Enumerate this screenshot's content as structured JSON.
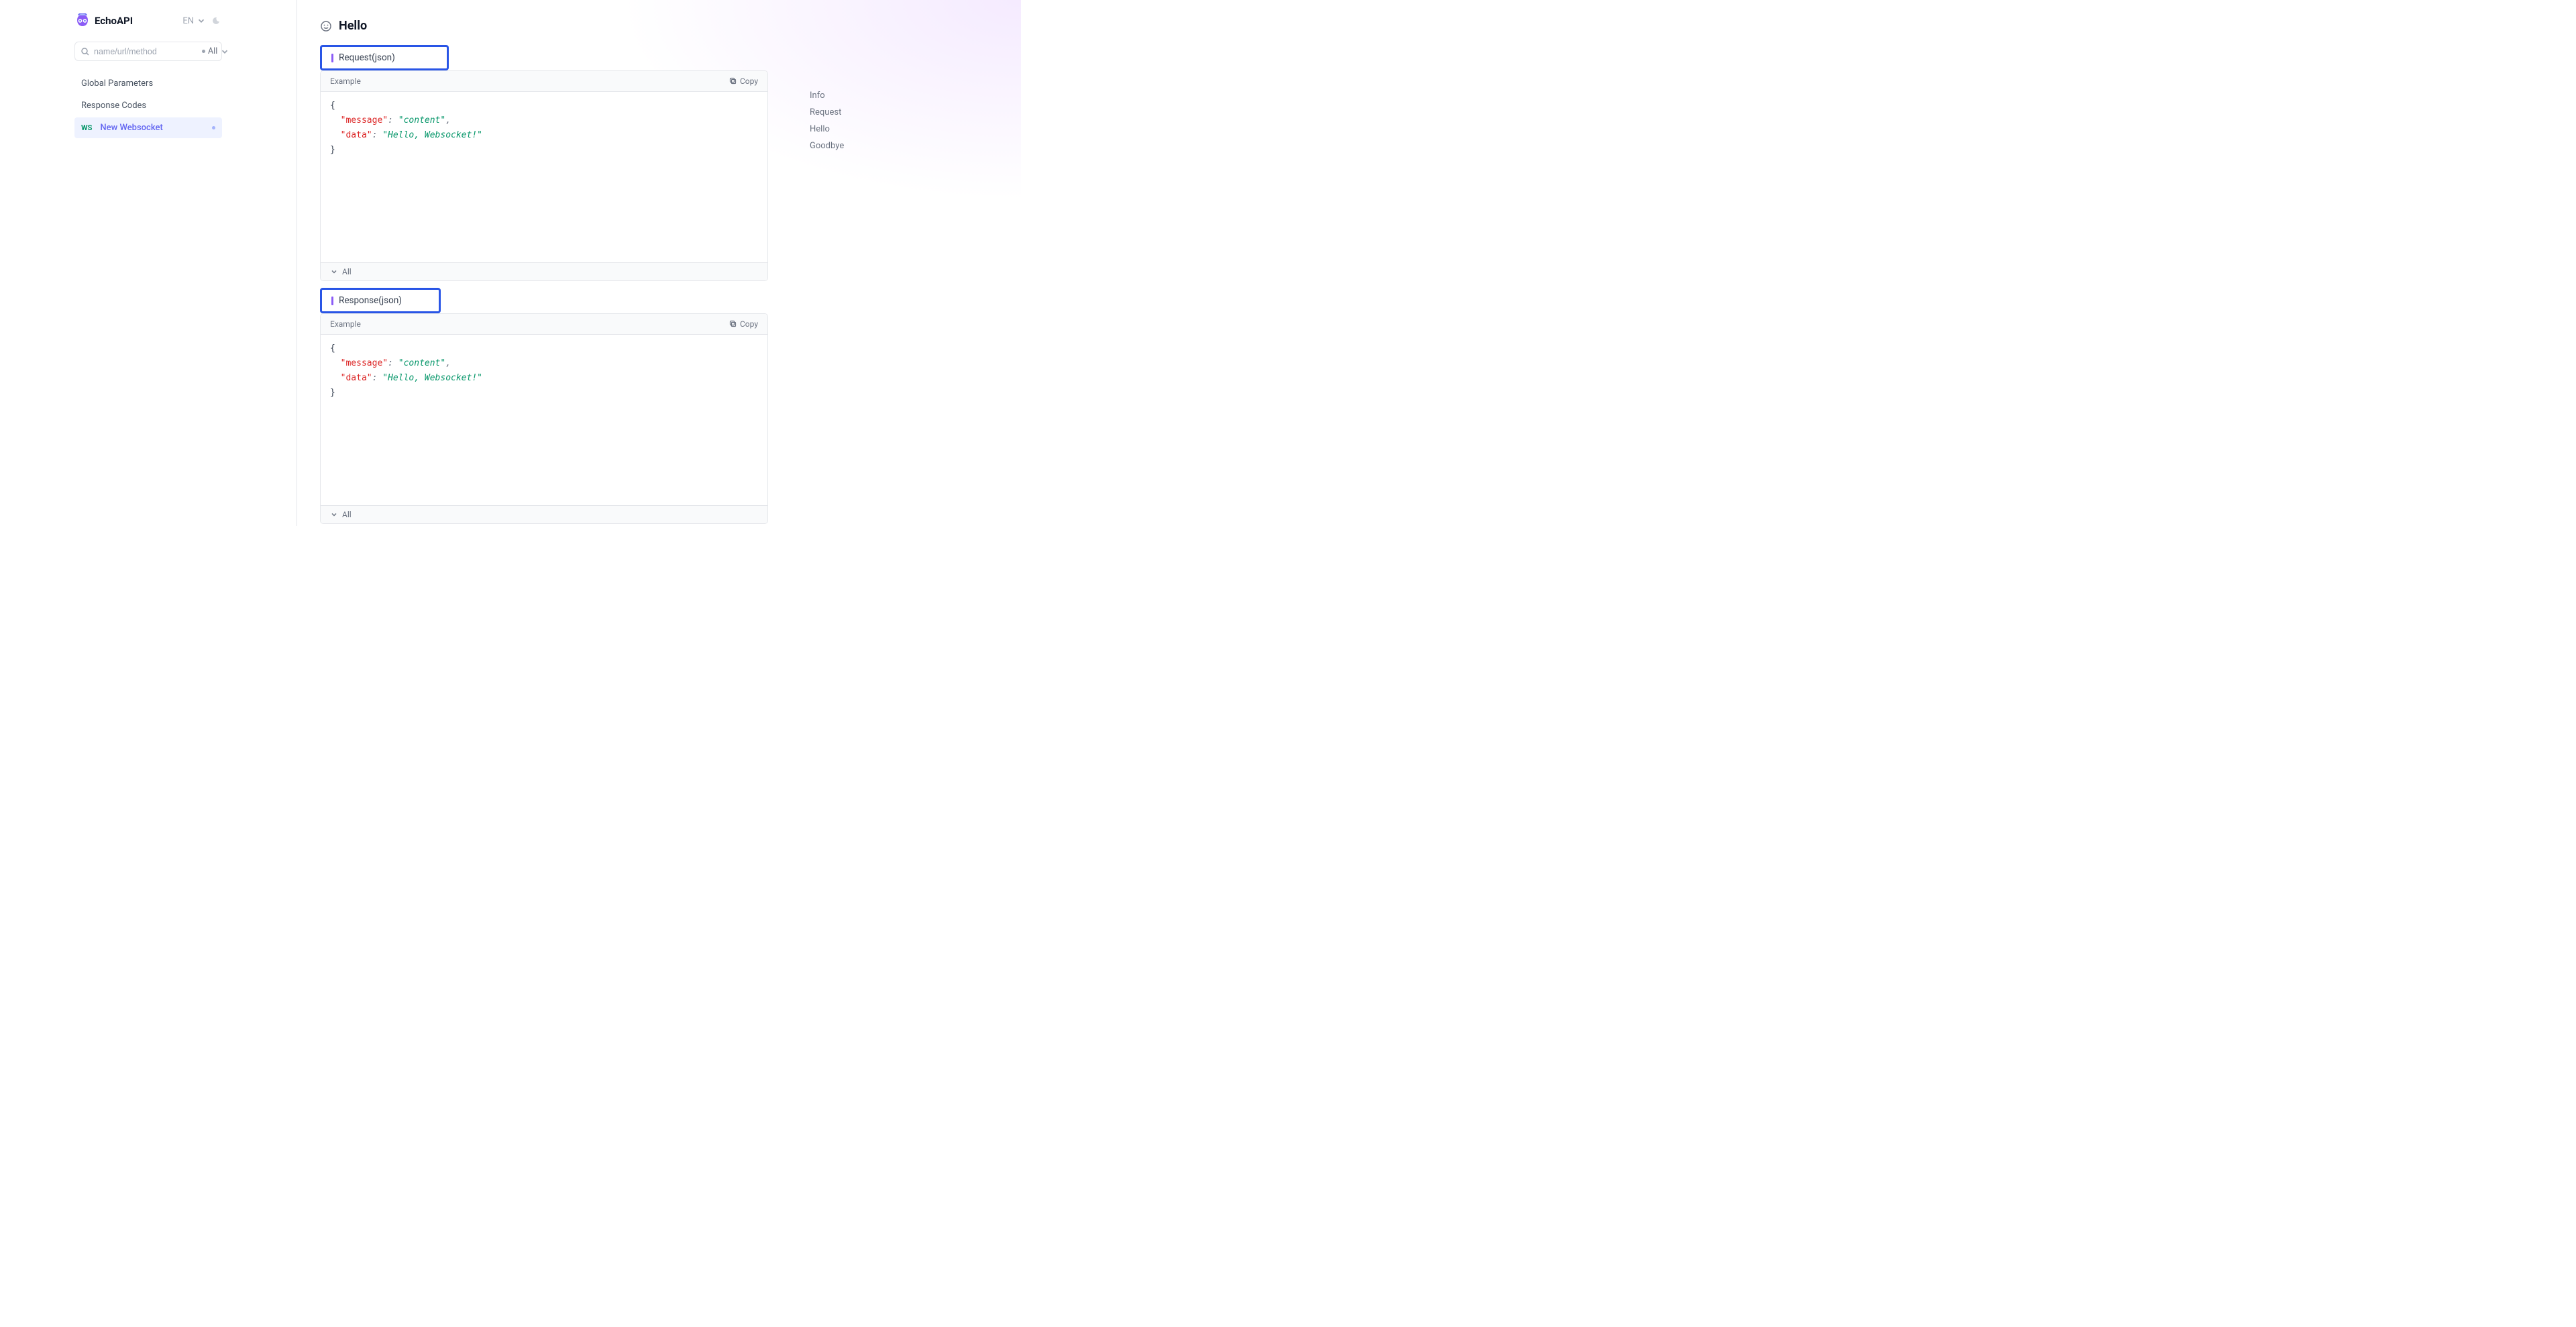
{
  "brand": "EchoAPI",
  "lang": "EN",
  "search": {
    "placeholder": "name/url/method",
    "filter_label": "All"
  },
  "sidebar": {
    "items": [
      {
        "label": "Global Parameters"
      },
      {
        "label": "Response Codes"
      },
      {
        "badge": "WS",
        "label": "New Websocket"
      }
    ]
  },
  "page_title": "Hello",
  "request_section": {
    "title": "Request(json)",
    "example_label": "Example",
    "copy_label": "Copy",
    "footer_label": "All",
    "json": {
      "key1": "\"message\"",
      "val1": "\"content\"",
      "key2": "\"data\"",
      "val2": "\"Hello, Websocket!\""
    }
  },
  "response_section": {
    "title": "Response(json)",
    "example_label": "Example",
    "copy_label": "Copy",
    "footer_label": "All",
    "json": {
      "key1": "\"message\"",
      "val1": "\"content\"",
      "key2": "\"data\"",
      "val2": "\"Hello, Websocket!\""
    }
  },
  "right_nav": [
    "Info",
    "Request",
    "Hello",
    "Goodbye"
  ]
}
